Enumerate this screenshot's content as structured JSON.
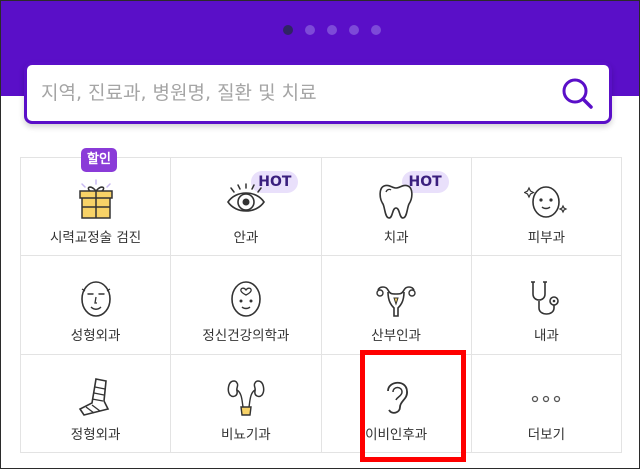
{
  "search": {
    "placeholder": "지역, 진료과, 병원명, 질환 및 치료"
  },
  "carousel": {
    "total_dots": 5,
    "active_dot": 1
  },
  "colors": {
    "brand_purple": "#5a0fc8",
    "badge_hot_bg": "#e9e0fb",
    "badge_sale_bg": "#8a3bd8",
    "highlight": "#ff0000"
  },
  "categories": [
    {
      "label": "시력교정술 검진",
      "icon": "gift-icon",
      "badge": "할인"
    },
    {
      "label": "안과",
      "icon": "eye-icon",
      "badge": "HOT"
    },
    {
      "label": "치과",
      "icon": "tooth-icon",
      "badge": "HOT"
    },
    {
      "label": "피부과",
      "icon": "face-sparkle-icon",
      "badge": ""
    },
    {
      "label": "성형외과",
      "icon": "face-icon",
      "badge": ""
    },
    {
      "label": "정신건강의학과",
      "icon": "heart-face-icon",
      "badge": ""
    },
    {
      "label": "산부인과",
      "icon": "uterus-icon",
      "badge": ""
    },
    {
      "label": "내과",
      "icon": "stethoscope-icon",
      "badge": ""
    },
    {
      "label": "정형외과",
      "icon": "cast-leg-icon",
      "badge": ""
    },
    {
      "label": "비뇨기과",
      "icon": "kidney-icon",
      "badge": ""
    },
    {
      "label": "이비인후과",
      "icon": "ear-icon",
      "badge": ""
    },
    {
      "label": "더보기",
      "icon": "more-dots-icon",
      "badge": ""
    }
  ]
}
